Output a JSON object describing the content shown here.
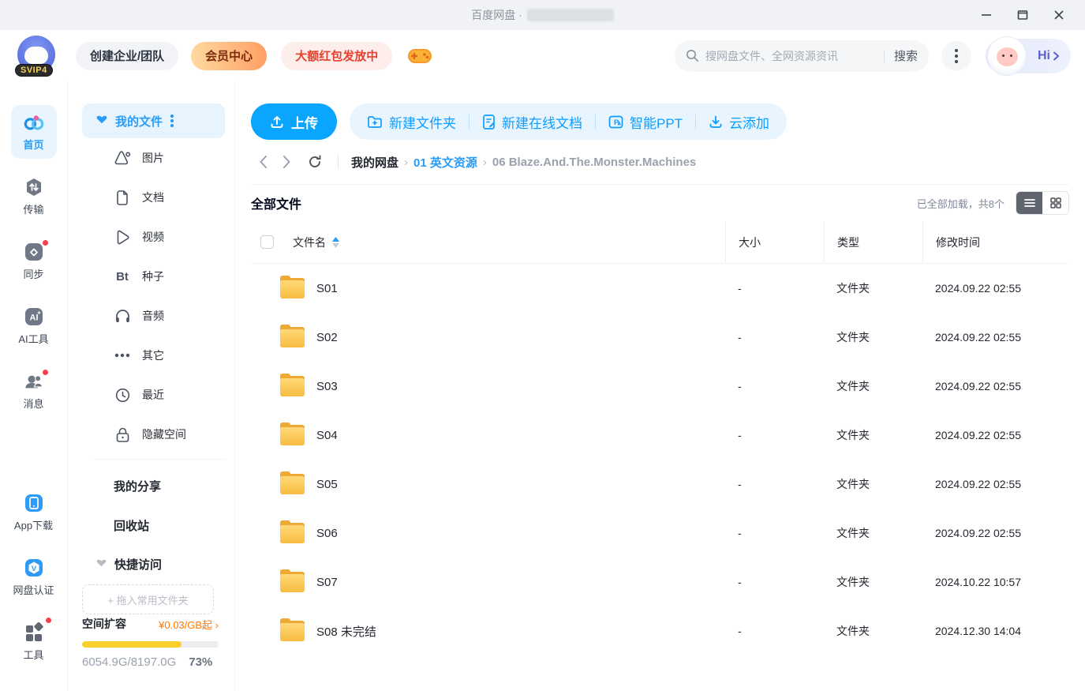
{
  "window": {
    "title": "百度网盘 ·"
  },
  "header": {
    "logo_badge": "SVIP4",
    "create_team_label": "创建企业/团队",
    "vip_center_label": "会员中心",
    "red_packet_label": "大额红包发放中",
    "search": {
      "placeholder": "搜网盘文件、全网资源资讯",
      "button_label": "搜索"
    },
    "greeting": "Hi"
  },
  "nav_rail": {
    "items": [
      {
        "label": "首页",
        "active": true
      },
      {
        "label": "传输"
      },
      {
        "label": "同步",
        "badge": true
      },
      {
        "label": "AI工具"
      },
      {
        "label": "消息",
        "badge": true
      }
    ],
    "bottom_items": [
      {
        "label": "App下载"
      },
      {
        "label": "网盘认证"
      },
      {
        "label": "工具",
        "badge": true
      }
    ]
  },
  "sidebar": {
    "my_files_label": "我的文件",
    "categories": [
      "图片",
      "文档",
      "视频",
      "种子",
      "音频",
      "其它",
      "最近",
      "隐藏空间"
    ],
    "bt_glyph": "Bt",
    "my_share_label": "我的分享",
    "recycle_label": "回收站",
    "quick_access_label": "快捷访问",
    "drop_hint": "+ 拖入常用文件夹",
    "storage": {
      "expand_label": "空间扩容",
      "price_label": "¥0.03/GB起 ›",
      "usage": "6054.9G/8197.0G",
      "percent_label": "73%",
      "percent_value": 73,
      "bar_color": "#fccf2b"
    }
  },
  "toolbar": {
    "upload_label": "上传",
    "actions": [
      "新建文件夹",
      "新建在线文档",
      "智能PPT",
      "云添加"
    ],
    "accent_color": "#09a5ff"
  },
  "breadcrumb": {
    "items": [
      "我的网盘",
      "01 英文资源",
      "06 Blaze.And.The.Monster.Machines"
    ]
  },
  "filelist": {
    "title": "全部文件",
    "load_status": "已全部加载，共8个",
    "columns": {
      "name": "文件名",
      "size": "大小",
      "type": "类型",
      "modified": "修改时间"
    },
    "rows": [
      {
        "name": "S01",
        "size": "-",
        "type": "文件夹",
        "modified": "2024.09.22 02:55"
      },
      {
        "name": "S02",
        "size": "-",
        "type": "文件夹",
        "modified": "2024.09.22 02:55"
      },
      {
        "name": "S03",
        "size": "-",
        "type": "文件夹",
        "modified": "2024.09.22 02:55"
      },
      {
        "name": "S04",
        "size": "-",
        "type": "文件夹",
        "modified": "2024.09.22 02:55"
      },
      {
        "name": "S05",
        "size": "-",
        "type": "文件夹",
        "modified": "2024.09.22 02:55"
      },
      {
        "name": "S06",
        "size": "-",
        "type": "文件夹",
        "modified": "2024.09.22 02:55"
      },
      {
        "name": "S07",
        "size": "-",
        "type": "文件夹",
        "modified": "2024.10.22 10:57"
      },
      {
        "name": "S08 未完结",
        "size": "-",
        "type": "文件夹",
        "modified": "2024.12.30 14:04"
      }
    ]
  }
}
